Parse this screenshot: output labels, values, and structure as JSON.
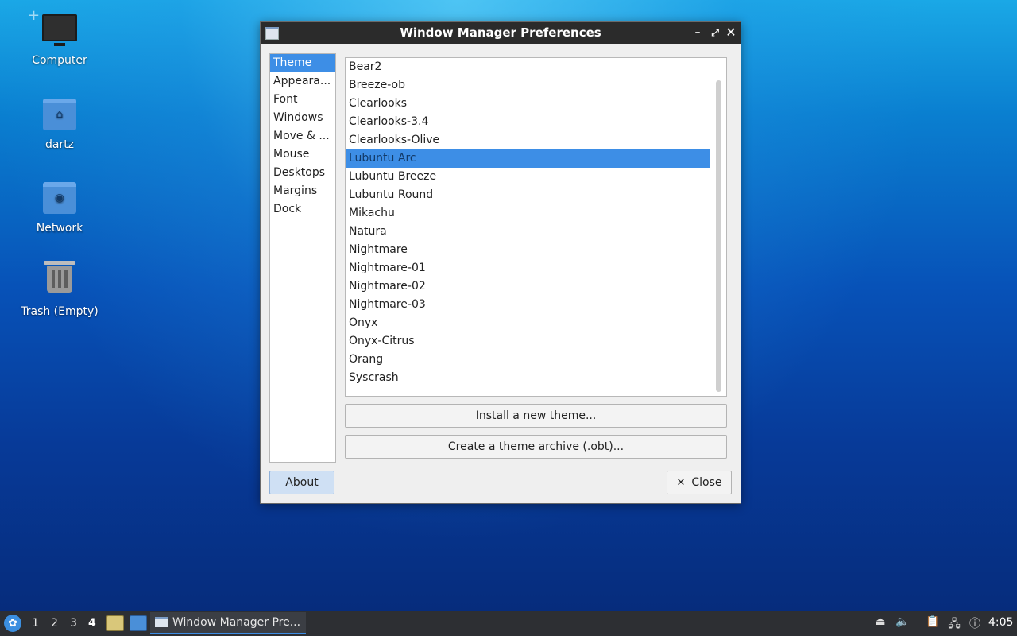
{
  "desktop": {
    "icons": [
      {
        "label": "Computer"
      },
      {
        "label": "dartz"
      },
      {
        "label": "Network"
      },
      {
        "label": "Trash (Empty)"
      }
    ]
  },
  "window": {
    "title": "Window Manager Preferences",
    "controls": {
      "minimize": "–",
      "maximize": "⤢",
      "close": "✕"
    },
    "sidebar": {
      "items": [
        "Theme",
        "Appeara...",
        "Font",
        "Windows",
        "Move & ...",
        "Mouse",
        "Desktops",
        "Margins",
        "Dock"
      ],
      "selected": "Theme"
    },
    "themes": {
      "items": [
        "Bear2",
        "Breeze-ob",
        "Clearlooks",
        "Clearlooks-3.4",
        "Clearlooks-Olive",
        "Lubuntu Arc",
        "Lubuntu Breeze",
        "Lubuntu Round",
        "Mikachu",
        "Natura",
        "Nightmare",
        "Nightmare-01",
        "Nightmare-02",
        "Nightmare-03",
        "Onyx",
        "Onyx-Citrus",
        "Orang",
        "Syscrash"
      ],
      "selected": "Lubuntu Arc"
    },
    "buttons": {
      "install": "Install a new theme...",
      "archive": "Create a theme archive (.obt)...",
      "about": "About",
      "close": "Close",
      "close_icon": "✕"
    }
  },
  "taskbar": {
    "workspaces": [
      "1",
      "2",
      "3",
      "4"
    ],
    "active_workspace": "4",
    "task_label": "Window Manager Pre...",
    "clock": "4:05"
  },
  "colors": {
    "selection": "#3d8ee6",
    "titlebar": "#2b2b2b",
    "taskbar": "#2d2f33"
  }
}
